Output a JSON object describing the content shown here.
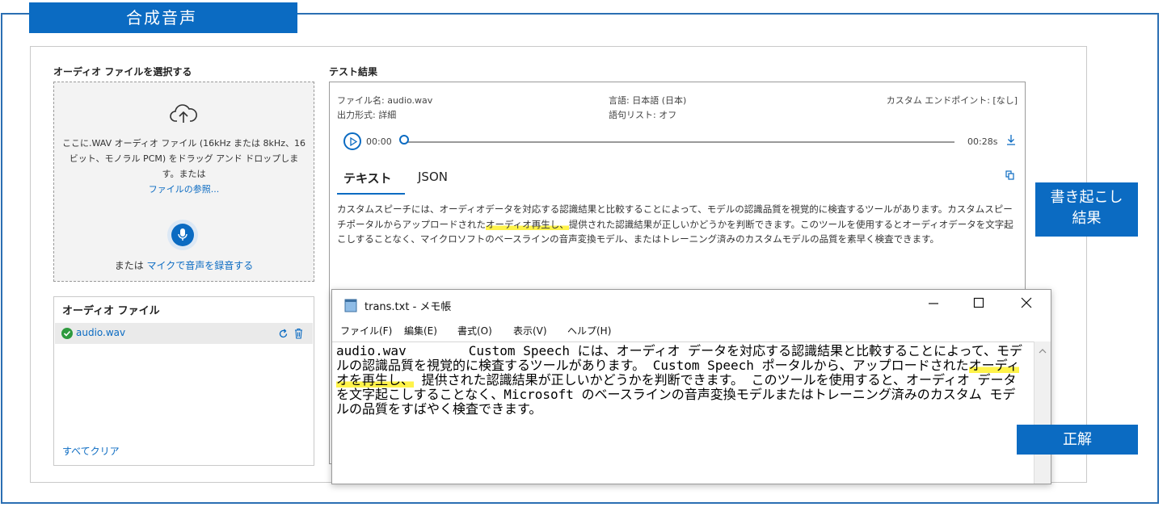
{
  "header": {
    "title": "合成音声"
  },
  "left": {
    "select_heading": "オーディオ ファイルを選択する",
    "dropzone_text": "ここに.WAV オーディオ ファイル (16kHz または 8kHz、16 ビット、モノラル PCM) をドラッグ アンド ドロップします。または",
    "browse_link": "ファイルの参照...",
    "or_label": "または",
    "record_link": "マイクで音声を録音する",
    "files_heading": "オーディオ ファイル",
    "files": [
      {
        "name": "audio.wav",
        "status": "success"
      }
    ],
    "clear_all": "すべてクリア"
  },
  "results": {
    "heading": "テスト結果",
    "file_name": "ファイル名: audio.wav",
    "output_format": "出力形式: 詳細",
    "language": "言語: 日本語 (日本)",
    "phrase_list": "語句リスト: オフ",
    "custom_endpoint": "カスタム エンドポイント: [なし]",
    "time_current": "00:00",
    "time_total": "00:28s",
    "tabs": [
      {
        "label": "テキスト",
        "active": true
      },
      {
        "label": "JSON",
        "active": false
      }
    ],
    "transcript_before": "カスタムスピーチには、オーディオデータを対応する認識結果と比較することによって、モデルの認識品質を視覚的に検査するツールがあります。カスタムスピーチポータルからアップロードされた",
    "transcript_highlight": "オーディオ再生し、",
    "transcript_after": "提供された認識結果が正しいかどうかを判断できます。このツールを使用するとオーディオデータを文字起こしすることなく、マイクロソフトのベースラインの音声変換モデル、またはトレーニング済みのカスタムモデルの品質を素早く検査できます。"
  },
  "callouts": {
    "transcription_line1": "書き起こし",
    "transcription_line2": "結果",
    "answer": "正解"
  },
  "notepad": {
    "title": "trans.txt - メモ帳",
    "menu": [
      "ファイル(F)",
      "編集(E)",
      "書式(O)",
      "表示(V)",
      "ヘルプ(H)"
    ],
    "content_before": "audio.wav\t Custom Speech には、オーディオ データを対応する認識結果と比較することによって、モデルの認識品質を視覚的に検査するツールがあります。 Custom Speech ポータルから、アップロードされた",
    "content_highlight": "オーディオを再生し、",
    "content_after": " 提供された認識結果が正しいかどうかを判断できます。 このツールを使用すると、オーディオ データを文字起こしすることなく、Microsoft のベースラインの音声変換モデルまたはトレーニング済みのカスタム モデルの品質をすばやく検査できます。"
  },
  "colors": {
    "accent": "#0b6bc2",
    "highlight": "#fff34a",
    "success": "#2e9a3e"
  }
}
